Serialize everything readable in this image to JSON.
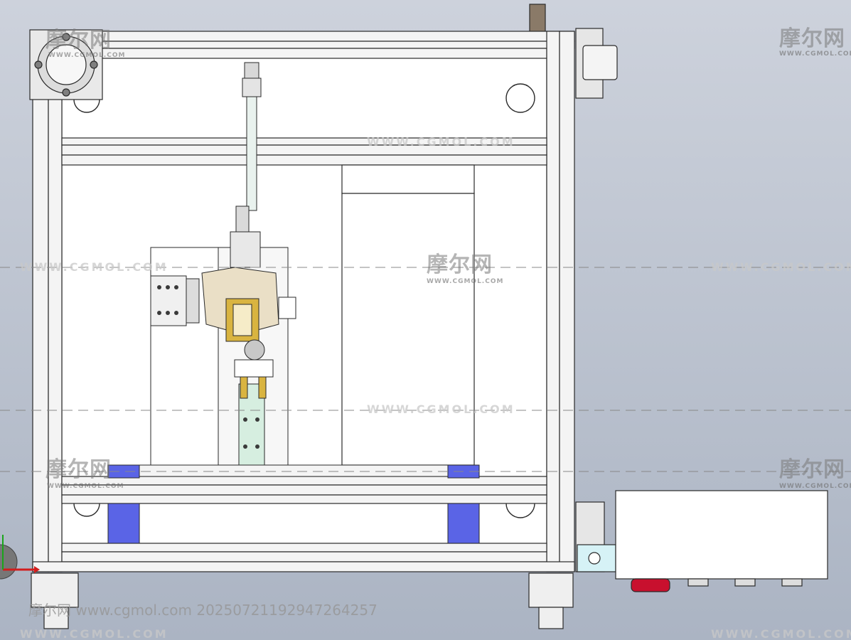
{
  "watermark": {
    "brand": "摩尔网",
    "domain": "WWW.CGMOL.COM",
    "footer": "摩尔网 www.cgmol.com 20250721192947264257"
  },
  "colors": {
    "background_top": "#c9ced8",
    "background_bottom": "#aeb7c6",
    "frame_fill": "#f4f4f4",
    "line": "#2a2a2a",
    "blue_blocks": "#5a64e6",
    "plate_tan": "#eadfc6",
    "bracket_yellow": "#d9b440",
    "guide_mint": "#d6eee0",
    "foot_red": "#c8102e",
    "cyan_bracket": "#d6f2f6"
  },
  "icons": {
    "axis_triad": "axis-triad-icon"
  }
}
